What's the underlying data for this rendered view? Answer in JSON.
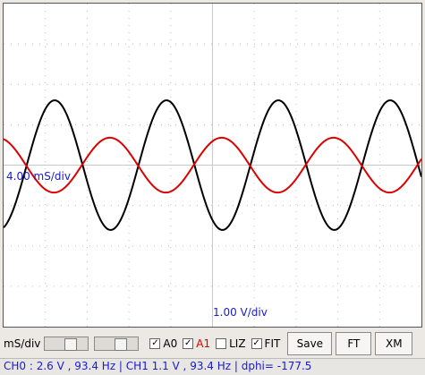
{
  "scope": {
    "timebase_label": "4.00 mS/div",
    "voltage_label": "1.00 V/div",
    "colors": {
      "grid": "#bdbdbd",
      "axis": "#c8c8c8",
      "ch0": "#000000",
      "ch1": "#dd0000"
    },
    "traces": [
      {
        "name": "A0",
        "amplitude_div": 2.6,
        "frequency_hz": 93.4,
        "phase_deg": 0,
        "color": "#000000"
      },
      {
        "name": "A1",
        "amplitude_div": 1.1,
        "frequency_hz": 93.4,
        "phase_deg": -177.5,
        "color": "#dd0000"
      }
    ],
    "time_per_div_ms": 4.0,
    "volts_per_div": 1.0
  },
  "controls": {
    "ms_div_label": "mS/div",
    "a0": {
      "label": "A0",
      "checked": true
    },
    "a1": {
      "label": "A1",
      "checked": true,
      "color": "#dd0000"
    },
    "liz": {
      "label": "LIZ",
      "checked": false
    },
    "fit": {
      "label": "FIT",
      "checked": true
    },
    "save_label": "Save",
    "ft_label": "FT",
    "xm_label": "XM"
  },
  "status": {
    "text": "CH0 :   2.6 V ,  93.4 Hz | CH1   1.1 V ,  93.4 Hz | dphi= -177.5"
  }
}
